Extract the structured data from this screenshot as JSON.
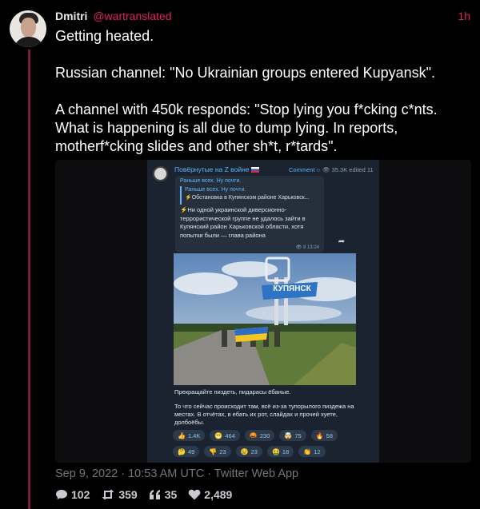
{
  "tweet": {
    "author_name": "Dmitri",
    "author_handle": "@wartranslated",
    "time_ago": "1h",
    "text_lines": [
      "Getting heated.",
      "",
      "Russian channel: \"No Ukrainian groups entered Kupyansk\".",
      "",
      "A channel with 450k responds: \"Stop lying you f*cking c*nts.",
      "What is happening is all due to dump lying. In reports,",
      "motherf*cking slides and other sh*t, r*tards\"."
    ],
    "timestamp": "Sep 9, 2022 · 10:53 AM UTC · Twitter Web App",
    "stats": {
      "comments": "102",
      "retweets": "359",
      "quotes": "35",
      "likes": "2,489"
    }
  },
  "embedded": {
    "channel_name": "Повёрнутые на Z войне",
    "comment_label": "Comment",
    "views": "35.3K edited 11",
    "forward_title": "Раньше всех. Ну почти.",
    "quote_title": "Раньше всех. Ну почти.",
    "quote_text": "⚡Обстановка в Купянском районе Харьковск...",
    "forward_body": "⚡Ни одной украинской диверсионно-террористической группе не удалось зайти в Купянский район Харьковской области, хотя попытки были — глава района",
    "forward_meta": "👁 8  13:24",
    "photo_sign": "КУПЯНСК",
    "caption_line1": "Прекращайте пиздеть, пидарасы ёбаные.",
    "caption_line2": "То что сейчас происходит там, всё из-за тупорылого пиздежа на местах. В отчётах, в ебать их рот, слайдах и прочей хуете, долбоёбы.",
    "reactions_row1": [
      {
        "icon": "👍",
        "count": "1.4K"
      },
      {
        "icon": "😁",
        "count": "464"
      },
      {
        "icon": "🤬",
        "count": "230"
      },
      {
        "icon": "🤯",
        "count": "75"
      },
      {
        "icon": "🔥",
        "count": "58"
      }
    ],
    "reactions_row2": [
      {
        "icon": "🤔",
        "count": "49"
      },
      {
        "icon": "👎",
        "count": "23"
      },
      {
        "icon": "😢",
        "count": "23"
      },
      {
        "icon": "🤮",
        "count": "18"
      },
      {
        "icon": "👏",
        "count": "12"
      }
    ]
  },
  "colors": {
    "accent": "#e0245e",
    "thread_line": "#7a1f35",
    "telegram_link": "#5eb5f7"
  }
}
